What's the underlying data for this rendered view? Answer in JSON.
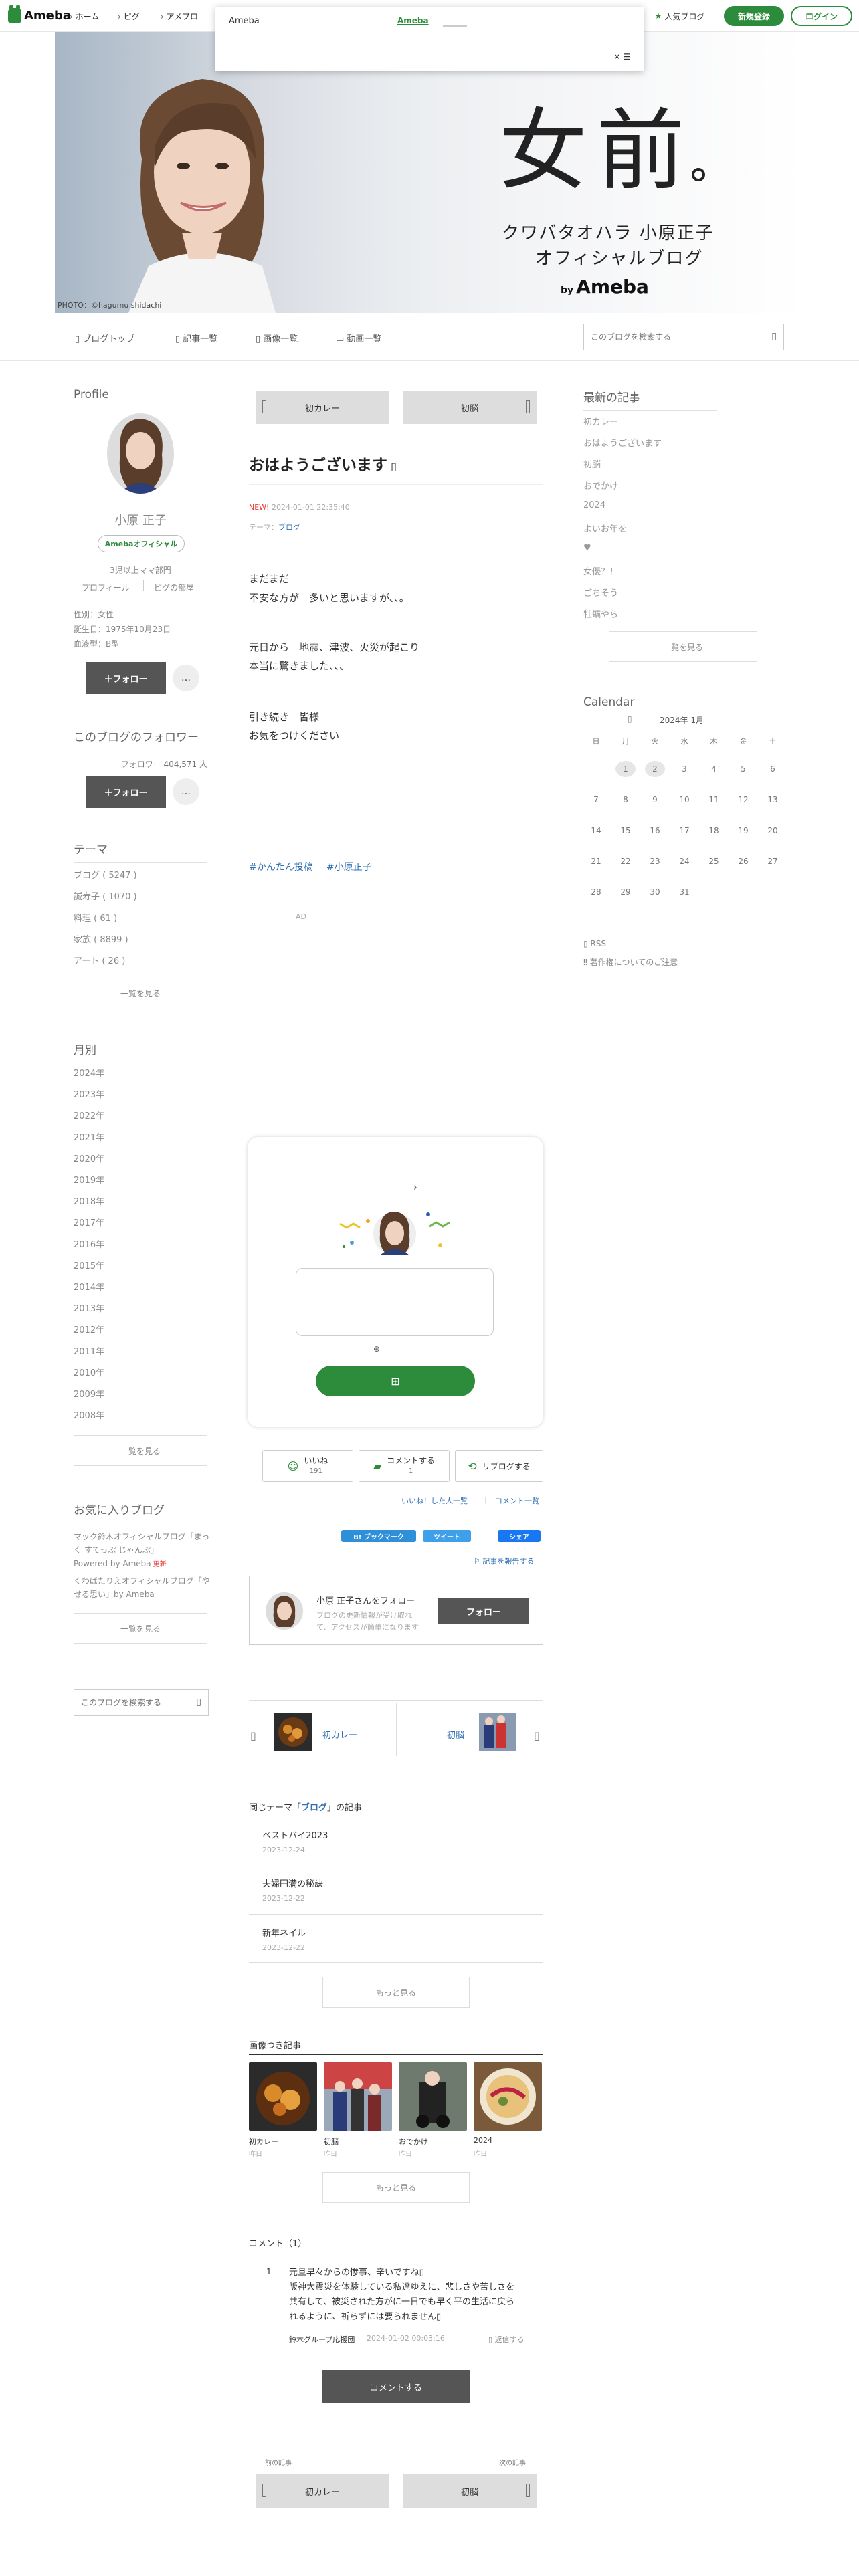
{
  "topbar": {
    "logo": "Ameba",
    "nav": [
      "ホーム",
      "ピグ",
      "アメブロ"
    ],
    "popup": {
      "left": "Ameba",
      "link": "Ameba",
      "close": "✕ ☰"
    },
    "popular": "人気ブログ",
    "signup": "新規登録",
    "login": "ログイン"
  },
  "header": {
    "title_big": "女前",
    "line1": "クワバタオハラ 小原正子",
    "line2": "オフィシャルブログ",
    "by": "by",
    "brand": "Ameba",
    "photo": "PHOTO：©hagumu shidachi"
  },
  "subnav": {
    "items": [
      "ブログトップ",
      "記事一覧",
      "画像一覧",
      "動画一覧"
    ],
    "search_placeholder": "このブログを検索する"
  },
  "profile": {
    "heading": "Profile",
    "name": "小原 正子",
    "badge": "Amebaオフィシャル",
    "rank": "3児以上ママ部門",
    "links": [
      "プロフィール",
      "ピグの部屋"
    ],
    "sex": "性別：女性",
    "birth": "誕生日：1975年10月23日",
    "blood": "血液型：B型",
    "follow": "＋フォロー",
    "more": "…"
  },
  "follower": {
    "heading": "このブログのフォロワー",
    "count": "フォロワー  404,571 人",
    "follow": "＋フォロー",
    "more": "…"
  },
  "theme": {
    "heading": "テーマ",
    "items": [
      "ブログ ( 5247 )",
      "誠寿子 ( 1070 )",
      "料理 ( 61 )",
      "家族 ( 8899 )",
      "アート ( 26 )"
    ],
    "more": "一覧を見る"
  },
  "months": {
    "heading": "月別",
    "items": [
      "2024年",
      "2023年",
      "2022年",
      "2021年",
      "2020年",
      "2019年",
      "2018年",
      "2017年",
      "2016年",
      "2015年",
      "2014年",
      "2013年",
      "2012年",
      "2011年",
      "2010年",
      "2009年",
      "2008年"
    ],
    "more": "一覧を見る"
  },
  "favorites": {
    "heading": "お気に入りブログ",
    "items": [
      "マック鈴木オフィシャルブログ「まっく すてっぷ じゃんぷ」",
      "Powered by Ameba",
      "くわばたりえオフィシャルブログ「やせる思い」by Ameba"
    ],
    "more": "一覧を見る",
    "search_placeholder": "このブログを検索する"
  },
  "nav_top": {
    "prev": "初カレー",
    "next": "初脳"
  },
  "article": {
    "title": "おはようございます",
    "new": "NEW!",
    "date": "2024-01-01 22:35:40",
    "theme_label": "テーマ：",
    "theme": "ブログ",
    "body": [
      "まだまだ",
      "不安な方が　多いと思いますが、、。",
      "元日から　地震、津波、火災が起こり",
      "本当に驚きました、、、",
      "引き続き　皆様",
      "お気をつけください"
    ],
    "tags": [
      "#かんたん投稿",
      "#小原正子"
    ],
    "ad": "AD"
  },
  "actions": {
    "like": "いいね",
    "like_count": "191",
    "comment": "コメントする",
    "comment_count": "1",
    "reblog": "リブログする",
    "like_users": "いいね！した人一覧",
    "comment_list": "コメント一覧",
    "hatena": "B! ブックマーク",
    "tweet": "ツイート",
    "share": "シェア",
    "report": "記事を報告する"
  },
  "followbox": {
    "title": "小原 正子さんをフォロー",
    "desc1": "ブログの更新情報が受け取れ",
    "desc2": "て、アクセスが簡単になります",
    "btn": "フォロー"
  },
  "pager": {
    "prev": "初カレー",
    "next": "初脳"
  },
  "same_theme": {
    "heading_a": "同じテーマ「",
    "theme": "ブログ",
    "heading_b": "」の記事",
    "items": [
      {
        "t": "ベストバイ2023",
        "d": "2023-12-24"
      },
      {
        "t": "夫婦円満の秘訣",
        "d": "2023-12-22"
      },
      {
        "t": "新年ネイル",
        "d": "2023-12-22"
      }
    ],
    "more": "もっと見る"
  },
  "image_articles": {
    "heading": "画像つき記事",
    "items": [
      {
        "t": "初カレー",
        "s": "昨日"
      },
      {
        "t": "初脳",
        "s": "昨日"
      },
      {
        "t": "おでかけ",
        "s": "昨日"
      },
      {
        "t": "2024",
        "s": "昨日"
      }
    ],
    "more": "もっと見る"
  },
  "comments": {
    "heading": "コメント（1）",
    "num": "1",
    "lines": [
      "元旦早々からの惨事、辛いですね",
      "阪神大震災を体験している私達ゆえに、悲しさや苦しさを",
      "共有して、被災された方がに一日でも早く平の生活に戻ら",
      "れるように、祈らずには要られません"
    ],
    "author": "鈴木グループ応援団",
    "date": "2024-01-02 00:03:16",
    "reply": "返信する",
    "btn": "コメントする"
  },
  "bottom_pager": {
    "prev_label": "前の記事",
    "next_label": "次の記事",
    "prev": "初カレー",
    "next": "初脳"
  },
  "recent": {
    "heading": "最新の記事",
    "items": [
      "初カレー",
      "おはようございます",
      "初脳",
      "おでかけ",
      "2024",
      "よいお年を",
      "♥",
      "女優？！",
      "ごちそう",
      "牡蠣やら"
    ],
    "more": "一覧を見る"
  },
  "calendar": {
    "heading": "Calendar",
    "month": "2024年 1月",
    "weekdays": [
      "日",
      "月",
      "火",
      "水",
      "木",
      "金",
      "土"
    ],
    "rows": [
      [
        "",
        "1",
        "2",
        "3",
        "4",
        "5",
        "6"
      ],
      [
        "7",
        "8",
        "9",
        "10",
        "11",
        "12",
        "13"
      ],
      [
        "14",
        "15",
        "16",
        "17",
        "18",
        "19",
        "20"
      ],
      [
        "21",
        "22",
        "23",
        "24",
        "25",
        "26",
        "27"
      ],
      [
        "28",
        "29",
        "30",
        "31",
        "",
        "",
        ""
      ]
    ],
    "highlighted": [
      "1",
      "2"
    ]
  },
  "rss": {
    "rss": "RSS",
    "copyright": "著作権についてのご注意"
  },
  "colors": {
    "green": "#2d8c3c",
    "link": "#2f6fb3",
    "dark_btn": "#555555"
  }
}
